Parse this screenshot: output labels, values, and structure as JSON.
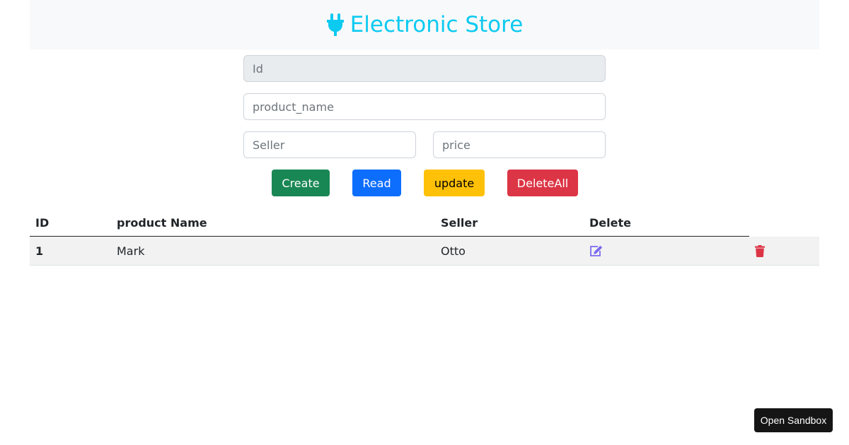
{
  "header": {
    "title": "Electronic Store",
    "icon": "plug-icon",
    "color": "#0dcaf0"
  },
  "form": {
    "id": {
      "placeholder": "Id",
      "value": ""
    },
    "product_name": {
      "placeholder": "product_name",
      "value": ""
    },
    "seller": {
      "placeholder": "Seller",
      "value": ""
    },
    "price": {
      "placeholder": "price",
      "value": ""
    }
  },
  "buttons": {
    "create": "Create",
    "read": "Read",
    "update": "update",
    "delete_all": "DeleteAll"
  },
  "table": {
    "columns": [
      "ID",
      "product Name",
      "Seller",
      "Delete"
    ],
    "rows": [
      {
        "id": "1",
        "product_name": "Mark",
        "seller": "Otto",
        "edit_icon": "edit-icon",
        "delete_icon": "trash-icon"
      }
    ]
  },
  "colors": {
    "create": "#198754",
    "read": "#0d6efd",
    "update": "#ffc107",
    "delete": "#dc3545",
    "edit_icon": "#7b6cf0"
  },
  "sandbox": {
    "label": "Open Sandbox"
  }
}
